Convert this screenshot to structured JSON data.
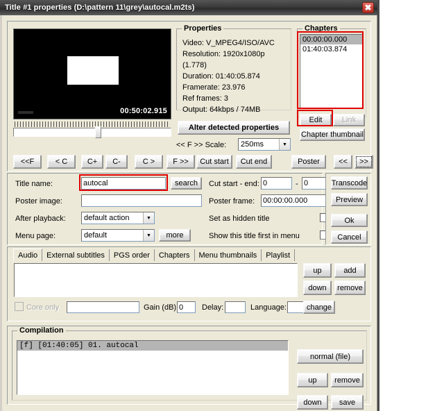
{
  "window": {
    "title": "Title #1 properties (D:\\pattern 11\\grey\\autocal.m2ts)",
    "close_label": "✖"
  },
  "preview": {
    "timestamp": "00:50:02.915"
  },
  "properties": {
    "group_title": "Properties",
    "lines": [
      "Video: V_MPEG4/ISO/AVC",
      "Resolution: 1920x1080p (1.778)",
      "Duration: 01:40:05.874",
      "Framerate: 23.976",
      "Ref frames: 3",
      "Output: 64kbps / 74MB"
    ],
    "alter_button": "Alter detected properties"
  },
  "chapters": {
    "group_title": "Chapters",
    "items": [
      "00:00:00.000",
      "01:40:03.874"
    ],
    "selected_index": 0,
    "edit_button": "Edit",
    "link_button": "Link",
    "thumbnail_button": "Chapter thumbnail"
  },
  "scale": {
    "label": "<< F >> Scale:",
    "value": "250ms",
    "arrow": "▼"
  },
  "nav_buttons": {
    "left": [
      "<<F",
      "< C",
      "C+",
      "C-",
      "C >",
      "F >>"
    ],
    "cut_start": "Cut start",
    "cut_end": "Cut end",
    "poster": "Poster",
    "prev": "<<",
    "next": ">>"
  },
  "form": {
    "title_name_label": "Title name:",
    "title_name_value": "autocal",
    "search_button": "search",
    "poster_image_label": "Poster image:",
    "poster_image_value": "",
    "after_playback_label": "After playback:",
    "after_playback_value": "default action",
    "menu_page_label": "Menu page:",
    "menu_page_value": "default",
    "more_button": "more",
    "cut_range_label": "Cut start - end:",
    "cut_start_value": "0",
    "cut_range_sep": "-",
    "cut_end_value": "0",
    "poster_frame_label": "Poster frame:",
    "poster_frame_value": "00:00:00.000",
    "hidden_title_label": "Set as hidden title",
    "show_first_label": "Show this title first in menu"
  },
  "actions": {
    "transcode": "Transcode",
    "preview": "Preview",
    "ok": "Ok",
    "cancel": "Cancel"
  },
  "tabs": {
    "items": [
      "Audio",
      "External subtitles",
      "PGS order",
      "Chapters",
      "Menu thumbnails",
      "Playlist"
    ],
    "active_index": 0,
    "list_items": [],
    "up_button": "up",
    "add_button": "add",
    "down_button": "down",
    "remove_button": "remove",
    "core_only_label": "Core only",
    "stream_value": "",
    "gain_label": "Gain (dB):",
    "gain_value": "0",
    "delay_label": "Delay:",
    "delay_value": "",
    "language_label": "Language:",
    "language_value": "",
    "change_button": "change"
  },
  "compilation": {
    "group_title": "Compilation",
    "items": [
      "[f] [01:40:05] 01. autocal"
    ],
    "selected_index": 0,
    "normal_button": "normal (file)",
    "up_button": "up",
    "remove_button": "remove",
    "down_button": "down",
    "save_button": "save"
  },
  "colors": {
    "annotation": "#e00000",
    "dialog_face": "#ece9d8",
    "title_bar": "#3a3a3a"
  }
}
